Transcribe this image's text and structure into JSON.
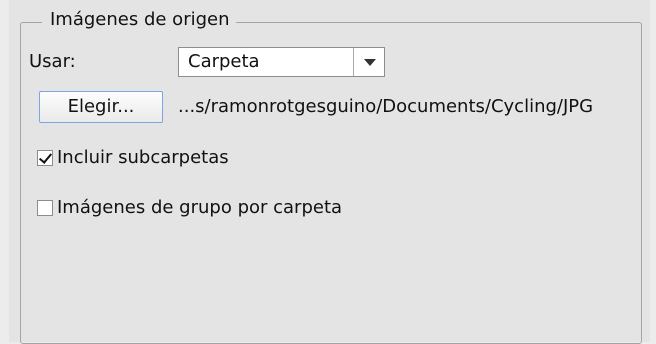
{
  "group": {
    "title": "Imágenes de origen"
  },
  "source": {
    "use_label": "Usar:",
    "use_value": "Carpeta"
  },
  "choose": {
    "button_label": "Elegir...",
    "path": "...s/ramonrotgesguino/Documents/Cycling/JPG"
  },
  "options": {
    "include_subfolders": {
      "label": "Incluir subcarpetas",
      "checked": true
    },
    "group_by_folder": {
      "label": "Imágenes de grupo por carpeta",
      "checked": false
    }
  },
  "icons": {
    "dropdown": "chevron-down-icon",
    "check": "checkmark-icon"
  }
}
